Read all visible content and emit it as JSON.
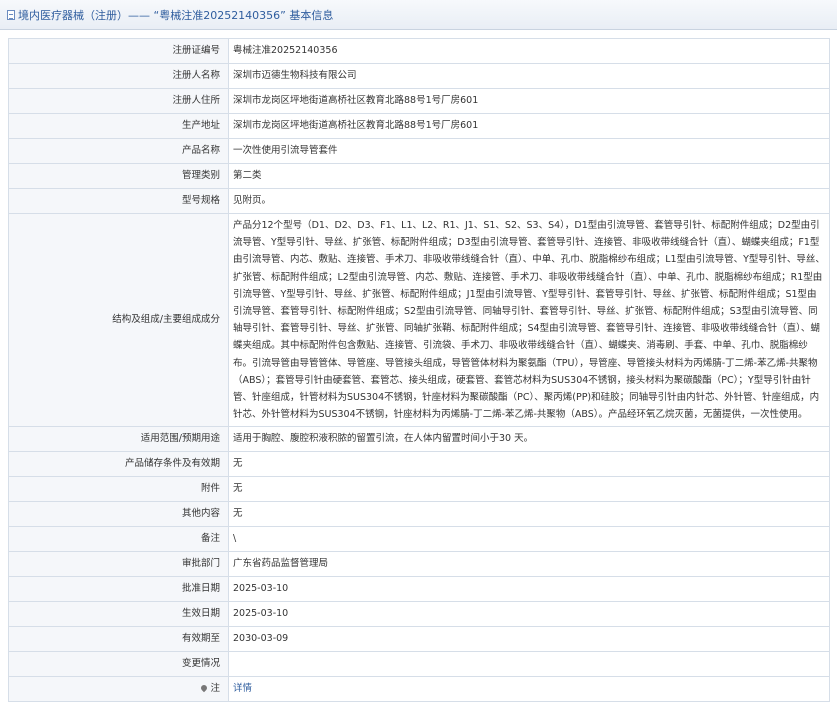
{
  "header": {
    "title": "境内医疗器械（注册）—— “粤械注准20252140356” 基本信息"
  },
  "rows": [
    {
      "label": "注册证编号",
      "value": "粤械注准20252140356"
    },
    {
      "label": "注册人名称",
      "value": "深圳市迈德生物科技有限公司"
    },
    {
      "label": "注册人住所",
      "value": "深圳市龙岗区坪地街道高桥社区教育北路88号1号厂房601"
    },
    {
      "label": "生产地址",
      "value": "深圳市龙岗区坪地街道高桥社区教育北路88号1号厂房601"
    },
    {
      "label": "产品名称",
      "value": "一次性使用引流导管套件"
    },
    {
      "label": "管理类别",
      "value": "第二类"
    },
    {
      "label": "型号规格",
      "value": "见附页。"
    },
    {
      "label": "结构及组成/主要组成成分",
      "value": "产品分12个型号（D1、D2、D3、F1、L1、L2、R1、J1、S1、S2、S3、S4），D1型由引流导管、套管导引针、标配附件组成；D2型由引流导管、Y型导引针、导丝、扩张管、标配附件组成；D3型由引流导管、套管导引针、连接管、非吸收带线缝合针（直）、蝴蝶夹组成；F1型由引流导管、内芯、敷贴、连接管、手术刀、非吸收带线缝合针（直）、中单、孔巾、脱脂棉纱布组成；L1型由引流导管、Y型导引针、导丝、扩张管、标配附件组成；L2型由引流导管、内芯、敷贴、连接管、手术刀、非吸收带线缝合针（直）、中单、孔巾、脱脂棉纱布组成；R1型由引流导管、Y型导引针、导丝、扩张管、标配附件组成；J1型由引流导管、Y型导引针、套管导引针、导丝、扩张管、标配附件组成；S1型由引流导管、套管导引针、标配附件组成；S2型由引流导管、同轴导引针、套管导引针、导丝、扩张管、标配附件组成；S3型由引流导管、同轴导引针、套管导引针、导丝、扩张管、同轴扩张鞘、标配附件组成；S4型由引流导管、套管导引针、连接管、非吸收带线缝合针（直）、蝴蝶夹组成。其中标配附件包含敷贴、连接管、引流袋、手术刀、非吸收带线缝合针（直）、蝴蝶夹、消毒刷、手套、中单、孔巾、脱脂棉纱布。引流导管由导管管体、导管座、导管接头组成，导管管体材料为聚氨酯（TPU），导管座、导管接头材料为丙烯腈-丁二烯-苯乙烯-共聚物（ABS）；套管导引针由硬套管、套管芯、接头组成，硬套管、套管芯材料为SUS304不锈钢，接头材料为聚碳酸酯（PC）；Y型导引针由针管、针座组成，针管材料为SUS304不锈钢，针座材料为聚碳酸酯（PC）、聚丙烯(PP)和硅胶；同轴导引针由内针芯、外针管、针座组成，内针芯、外针管材料为SUS304不锈钢，针座材料为丙烯腈-丁二烯-苯乙烯-共聚物（ABS）。产品经环氧乙烷灭菌，无菌提供，一次性使用。"
    },
    {
      "label": "适用范围/预期用途",
      "value": "适用于胸腔、腹腔积液积脓的留置引流，在人体内留置时间小于30 天。"
    },
    {
      "label": "产品储存条件及有效期",
      "value": "无"
    },
    {
      "label": "附件",
      "value": "无"
    },
    {
      "label": "其他内容",
      "value": "无"
    },
    {
      "label": "备注",
      "value": "\\"
    },
    {
      "label": "审批部门",
      "value": "广东省药品监督管理局"
    },
    {
      "label": "批准日期",
      "value": "2025-03-10"
    },
    {
      "label": "生效日期",
      "value": "2025-03-10"
    },
    {
      "label": "有效期至",
      "value": "2030-03-09"
    },
    {
      "label": "变更情况",
      "value": ""
    }
  ],
  "note_row": {
    "label": "注",
    "icon": "pin-icon",
    "link_text": "详情"
  }
}
